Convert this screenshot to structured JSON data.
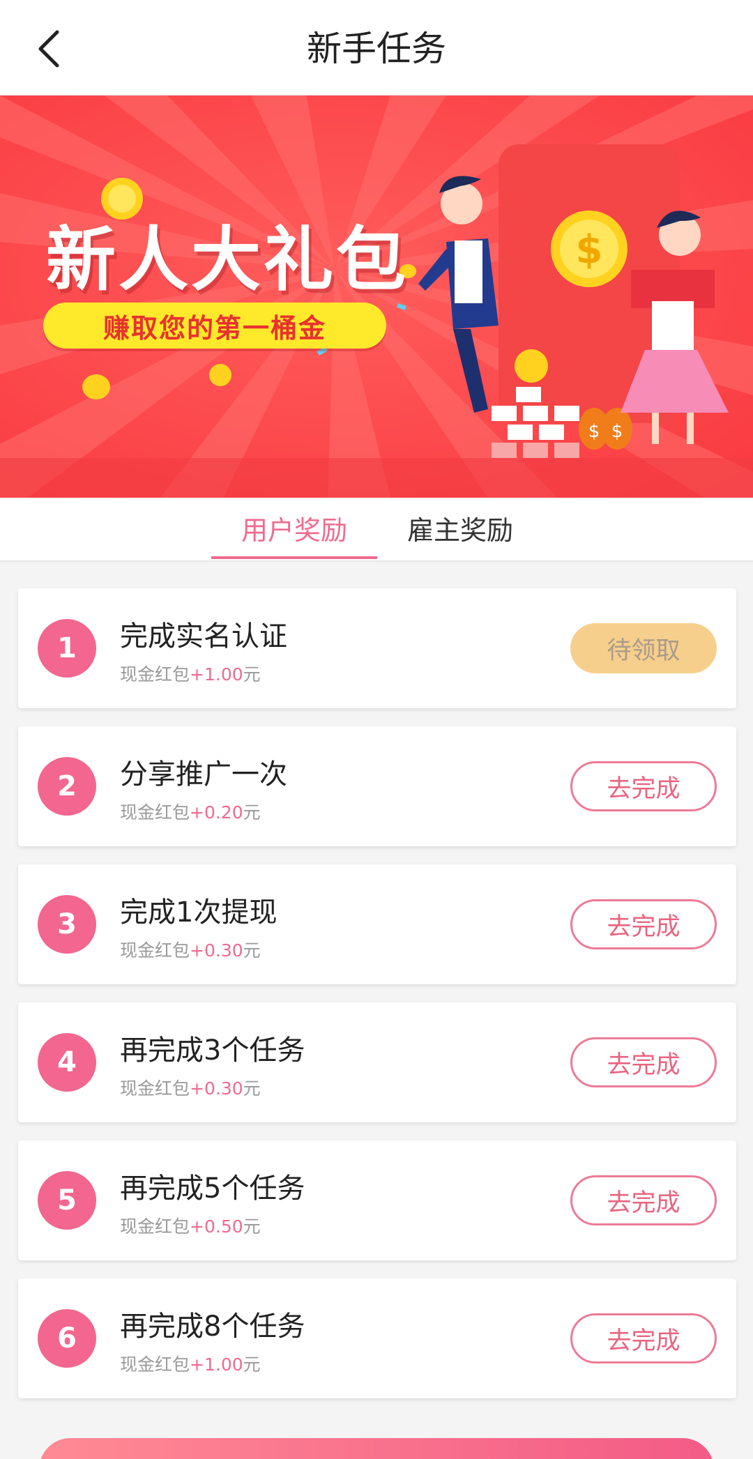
{
  "header": {
    "title": "新手任务",
    "back_icon": "chevron-left-icon"
  },
  "banner": {
    "title": "新人大礼包",
    "subtitle": "赚取您的第一桶金",
    "colors": {
      "background": "#fe4b4e",
      "pill": "#ffe92b",
      "pill_text": "#e8322f"
    }
  },
  "tabs": [
    {
      "label": "用户奖励",
      "active": true
    },
    {
      "label": "雇主奖励",
      "active": false
    }
  ],
  "tasks": [
    {
      "num": "1",
      "title": "完成实名认证",
      "reward_prefix": "现金红包",
      "reward_amount": "+1.00",
      "reward_unit": "元",
      "button": "待领取",
      "status": "pending"
    },
    {
      "num": "2",
      "title": "分享推广一次",
      "reward_prefix": "现金红包",
      "reward_amount": "+0.20",
      "reward_unit": "元",
      "button": "去完成",
      "status": "todo"
    },
    {
      "num": "3",
      "title": "完成1次提现",
      "reward_prefix": "现金红包",
      "reward_amount": "+0.30",
      "reward_unit": "元",
      "button": "去完成",
      "status": "todo"
    },
    {
      "num": "4",
      "title": "再完成3个任务",
      "reward_prefix": "现金红包",
      "reward_amount": "+0.30",
      "reward_unit": "元",
      "button": "去完成",
      "status": "todo"
    },
    {
      "num": "5",
      "title": "再完成5个任务",
      "reward_prefix": "现金红包",
      "reward_amount": "+0.50",
      "reward_unit": "元",
      "button": "去完成",
      "status": "todo"
    },
    {
      "num": "6",
      "title": "再完成8个任务",
      "reward_prefix": "现金红包",
      "reward_amount": "+1.00",
      "reward_unit": "元",
      "button": "去完成",
      "status": "todo"
    }
  ],
  "colors": {
    "accent": "#f06a8e",
    "number_badge": "#f2668f",
    "pending_button": "#f7cf8c"
  }
}
